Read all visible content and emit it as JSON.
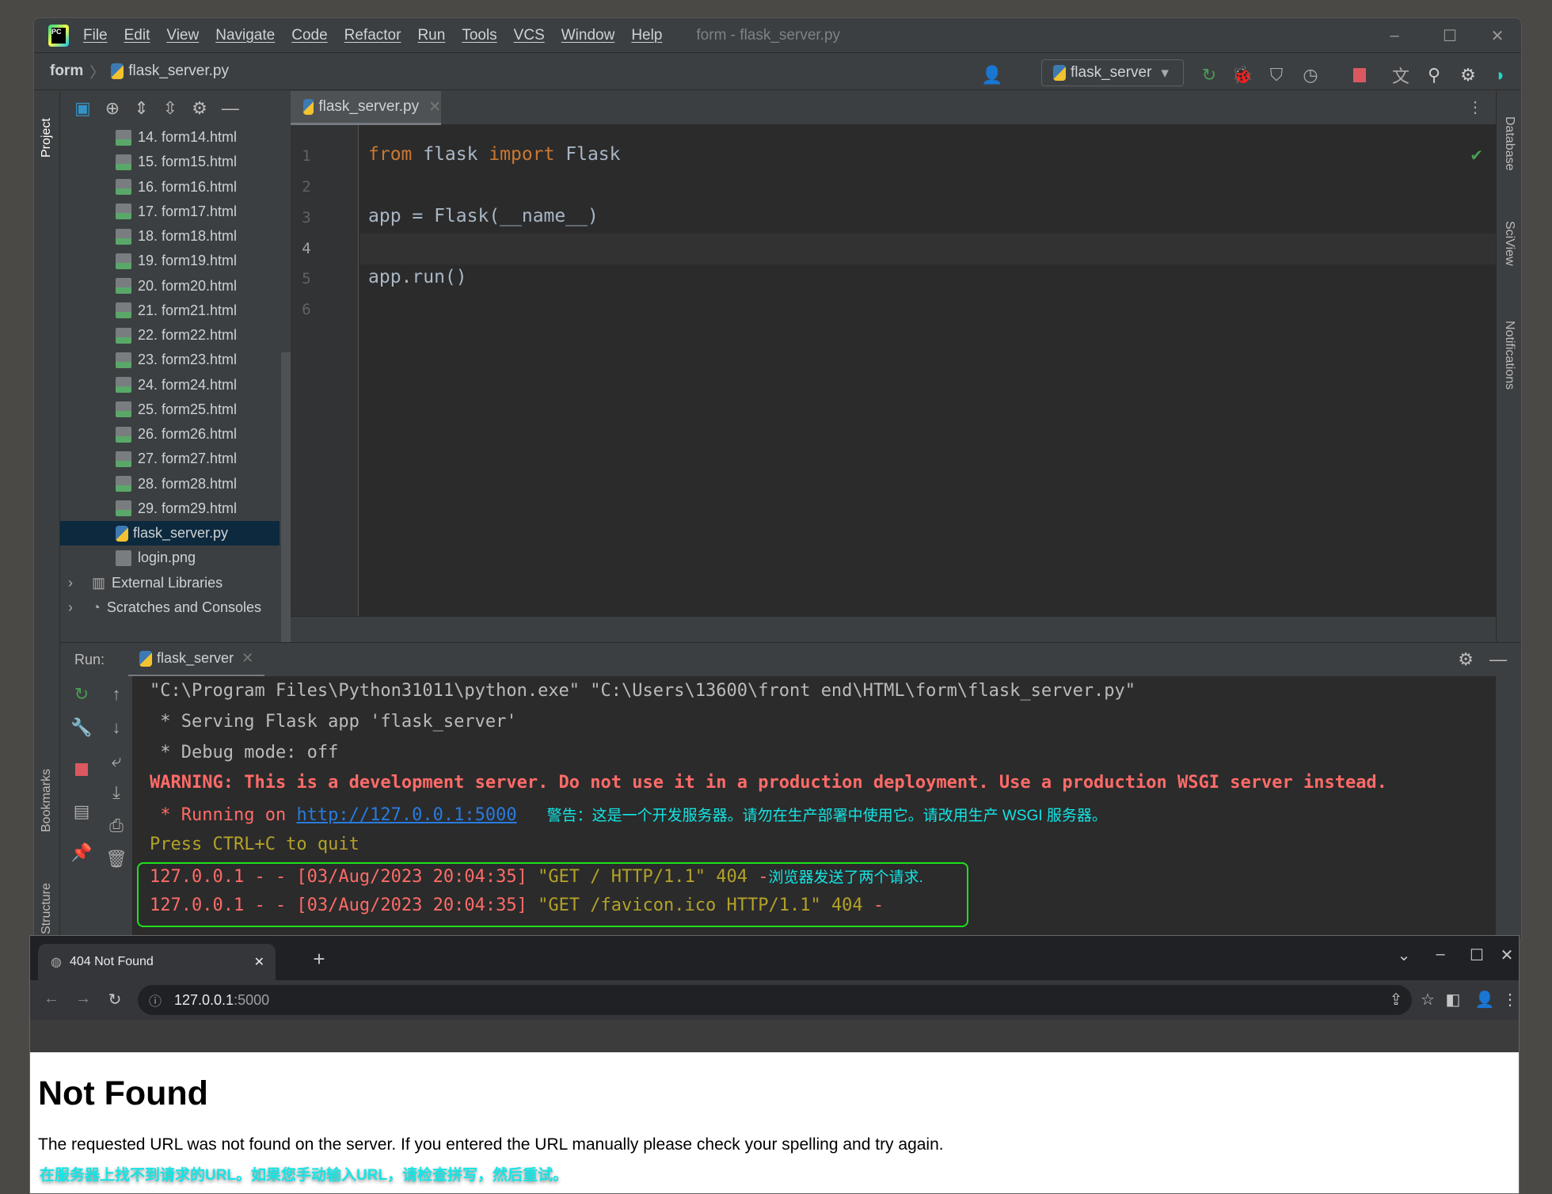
{
  "ide": {
    "menu": [
      "File",
      "Edit",
      "View",
      "Navigate",
      "Code",
      "Refactor",
      "Run",
      "Tools",
      "VCS",
      "Window",
      "Help"
    ],
    "window_title": "form - flask_server.py",
    "breadcrumb": {
      "project": "form",
      "file": "flask_server.py"
    },
    "run_config": "flask_server",
    "left_stripe": {
      "project": "Project",
      "bookmarks": "Bookmarks",
      "structure": "Structure"
    },
    "right_stripe": {
      "database": "Database",
      "sciview": "SciView",
      "notifications": "Notifications"
    },
    "tree": [
      "14. form14.html",
      "15. form15.html",
      "16. form16.html",
      "17. form17.html",
      "18. form18.html",
      "19. form19.html",
      "20. form20.html",
      "21. form21.html",
      "22. form22.html",
      "23. form23.html",
      "24. form24.html",
      "25. form25.html",
      "26. form26.html",
      "27. form27.html",
      "28. form28.html",
      "29. form29.html",
      "flask_server.py",
      "login.png"
    ],
    "tree_extra": [
      "External Libraries",
      "Scratches and Consoles"
    ],
    "editor_tab": "flask_server.py",
    "line_numbers": [
      "1",
      "2",
      "3",
      "4",
      "5",
      "6"
    ],
    "code": {
      "l1_kw1": "from",
      "l1_mod": " flask ",
      "l1_kw2": "import",
      "l1_name": " Flask",
      "l3": "app = Flask(__name__)",
      "l5": "app.run()"
    },
    "run": {
      "label": "Run:",
      "tab": "flask_server"
    },
    "console": {
      "l1": "\"C:\\Program Files\\Python31011\\python.exe\" \"C:\\Users\\13600\\front end\\HTML\\form\\flask_server.py\"",
      "l2": " * Serving Flask app 'flask_server'",
      "l3": " * Debug mode: off",
      "l4": "WARNING: This is a development server. Do not use it in a production deployment. Use a production WSGI server instead.",
      "l5_pre": " * Running on ",
      "l5_link": "http://127.0.0.1:5000",
      "l5_note": "警告：这是一个开发服务器。请勿在生产部署中使用它。请改用生产 WSGI 服务器。",
      "l6": "Press CTRL+C to quit",
      "l7_a": "127.0.0.1 - - [03/Aug/2023 20:04:35] ",
      "l7_b": "\"GET / HTTP/1.1\" 404",
      "l7_c": " -",
      "l7_note": "浏览器发送了两个请求.",
      "l8_a": "127.0.0.1 - - [03/Aug/2023 20:04:35] ",
      "l8_b": "\"GET /favicon.ico HTTP/1.1\" 404",
      "l8_c": " -"
    }
  },
  "browser": {
    "tab_title": "404 Not Found",
    "url_host": "127.0.0.1",
    "url_port": ":5000",
    "heading": "Not Found",
    "message": "The requested URL was not found on the server. If you entered the URL manually please check your spelling and try again.",
    "translation": "在服务器上找不到请求的URL。如果您手动输入URL，请检查拼写，然后重试。"
  }
}
